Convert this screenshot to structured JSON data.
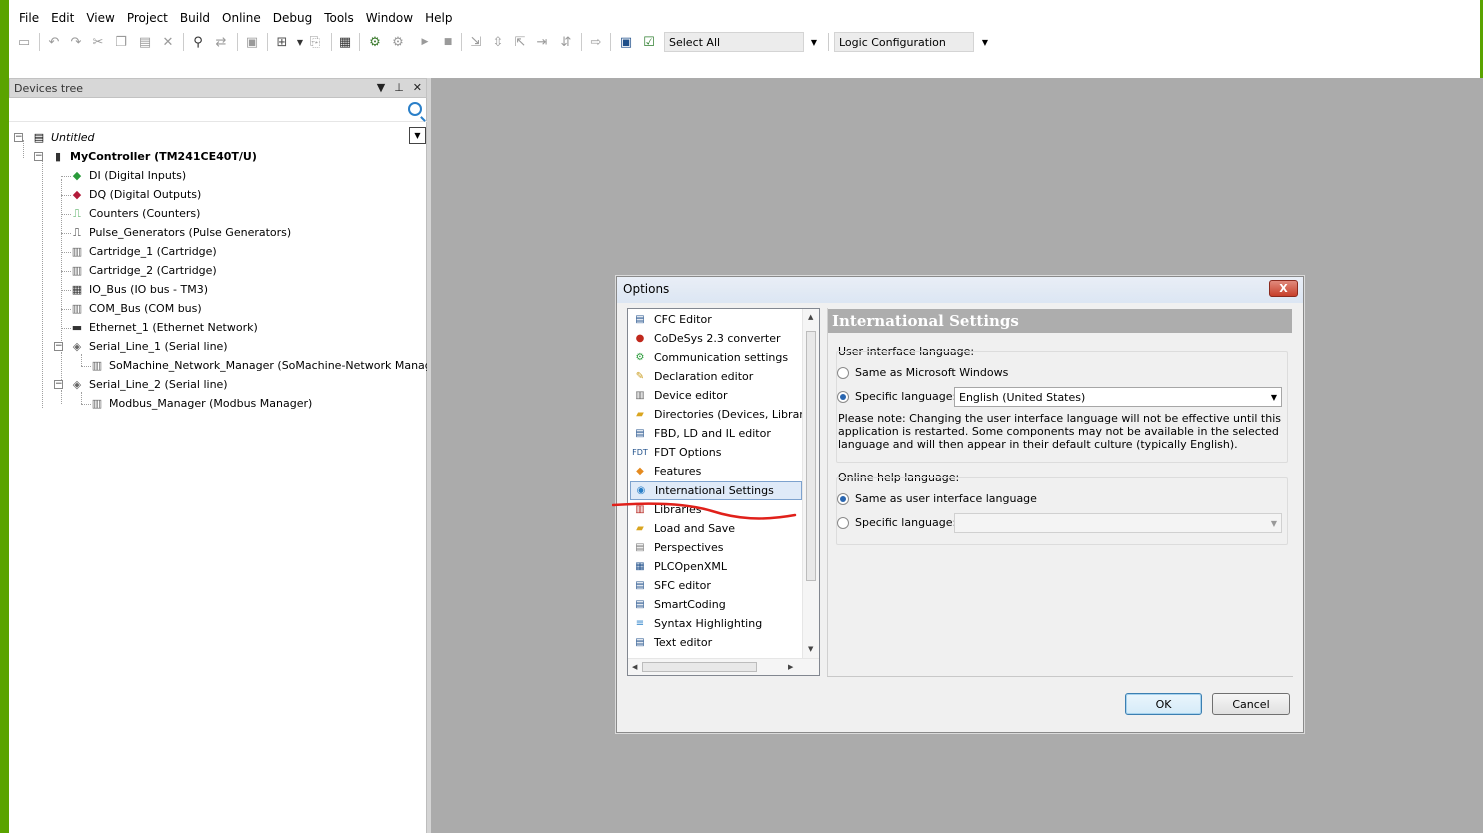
{
  "menu": [
    "File",
    "Edit",
    "View",
    "Project",
    "Build",
    "Online",
    "Debug",
    "Tools",
    "Window",
    "Help"
  ],
  "toolbar": {
    "select_all": "Select All",
    "logic_configuration": "Logic Configuration"
  },
  "devices_tree": {
    "title": "Devices tree",
    "root": "Untitled",
    "controller": "MyController (TM241CE40T/U)",
    "items": [
      "DI (Digital Inputs)",
      "DQ (Digital Outputs)",
      "Counters (Counters)",
      "Pulse_Generators (Pulse Generators)",
      "Cartridge_1 (Cartridge)",
      "Cartridge_2 (Cartridge)",
      "IO_Bus (IO bus - TM3)",
      "COM_Bus (COM bus)",
      "Ethernet_1 (Ethernet Network)",
      "Serial_Line_1 (Serial line)",
      "SoMachine_Network_Manager (SoMachine-Network Manager)",
      "Serial_Line_2 (Serial line)",
      "Modbus_Manager (Modbus Manager)"
    ]
  },
  "dialog": {
    "title": "Options",
    "close": "X",
    "categories": [
      "CFC Editor",
      "CoDeSys 2.3 converter",
      "Communication settings",
      "Declaration editor",
      "Device editor",
      "Directories (Devices, Librarie",
      "FBD, LD and IL editor",
      "FDT Options",
      "Features",
      "International Settings",
      "Libraries",
      "Load and Save",
      "Perspectives",
      "PLCOpenXML",
      "SFC editor",
      "SmartCoding",
      "Syntax Highlighting",
      "Text editor"
    ],
    "selected_category": "International Settings",
    "section_title": "International Settings",
    "ui_language": {
      "label": "User interface language:",
      "option_same": "Same as Microsoft Windows",
      "option_specific": "Specific language:",
      "selected": "specific",
      "language_value": "English (United States)",
      "note": "Please note: Changing the user interface language will not be effective until this application is restarted. Some components may not be available in the selected language and will then appear in their default culture (typically English)."
    },
    "help_language": {
      "label": "Online help language:",
      "option_same": "Same as user interface language",
      "option_specific": "Specific language:",
      "selected": "same",
      "language_value": ""
    },
    "ok": "OK",
    "cancel": "Cancel"
  },
  "colors": {
    "accent_green": "#5aa300",
    "annotation_red": "#e0201a",
    "workspace_gray": "#ababab"
  }
}
